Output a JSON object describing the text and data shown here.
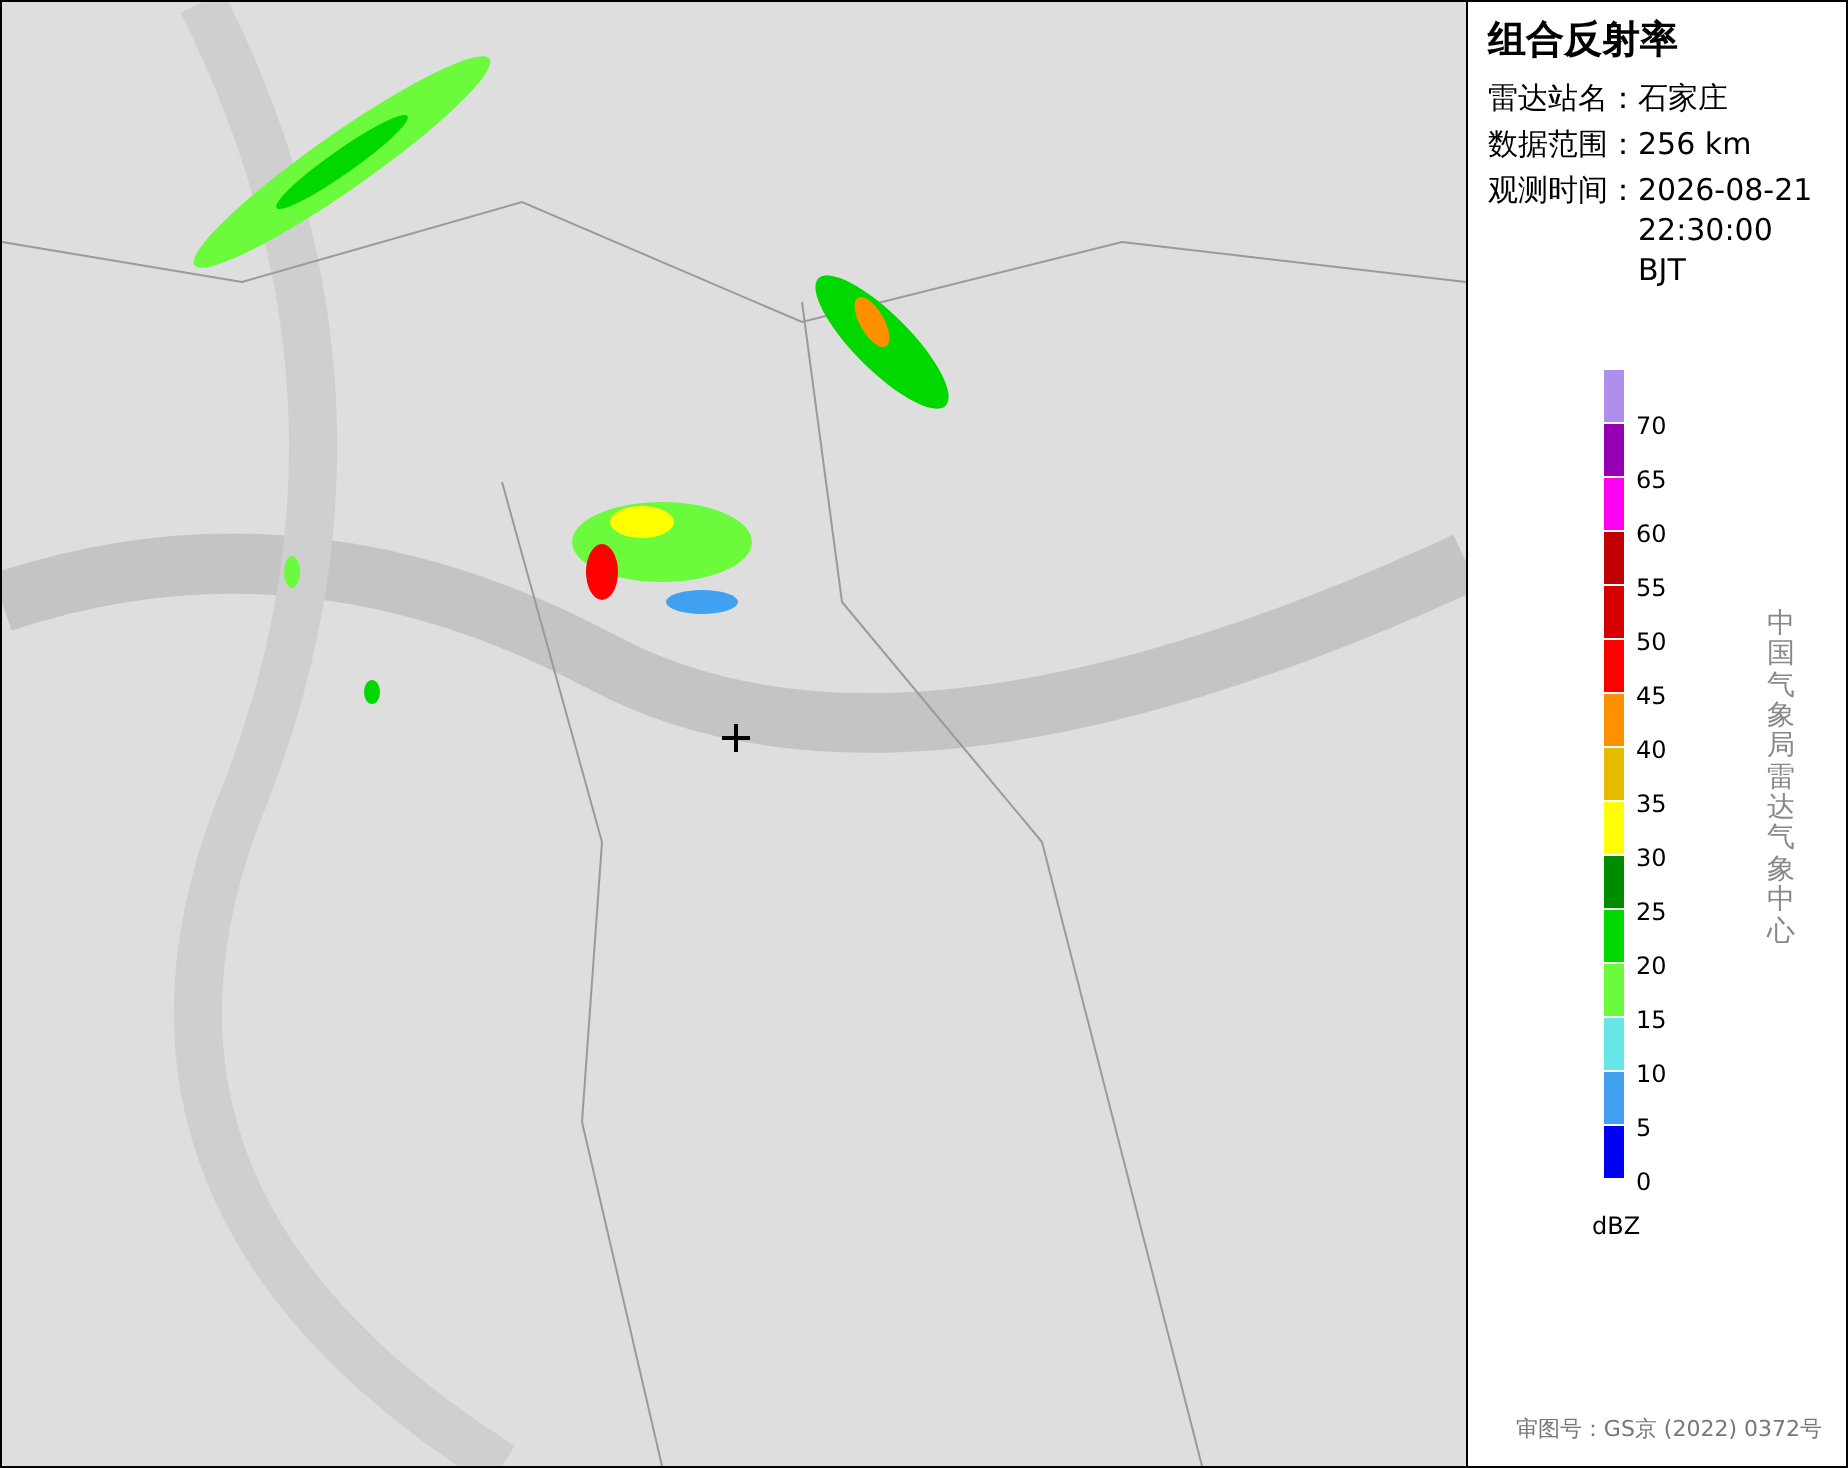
{
  "panel": {
    "title": "组合反射率",
    "info": [
      {
        "label": "雷达站名：",
        "value": "石家庄"
      },
      {
        "label": "数据范围：",
        "value": "256 km"
      },
      {
        "label": "观测时间：",
        "value": "2026-08-21 22:30:00 BJT"
      }
    ],
    "legend": {
      "segments": [
        {
          "color": "#ae90ec",
          "label": "70"
        },
        {
          "color": "#9600b4",
          "label": "65"
        },
        {
          "color": "#ff00f0",
          "label": "60"
        },
        {
          "color": "#c00000",
          "label": "55"
        },
        {
          "color": "#d60000",
          "label": "50"
        },
        {
          "color": "#ff0000",
          "label": "45"
        },
        {
          "color": "#ff9000",
          "label": "40"
        },
        {
          "color": "#e6bc00",
          "label": "35"
        },
        {
          "color": "#ffff00",
          "label": "30"
        },
        {
          "color": "#008c00",
          "label": "25"
        },
        {
          "color": "#00d800",
          "label": "20"
        },
        {
          "color": "#6cfa3d",
          "label": "15"
        },
        {
          "color": "#66e6e6",
          "label": "10"
        },
        {
          "color": "#42a0f0",
          "label": "5"
        },
        {
          "color": "#0000f6",
          "label": "0"
        }
      ],
      "unit": "dBZ"
    },
    "credit": "中国气象局雷达气象中心",
    "approval": "审图号：GS京 (2022) 0372号"
  }
}
